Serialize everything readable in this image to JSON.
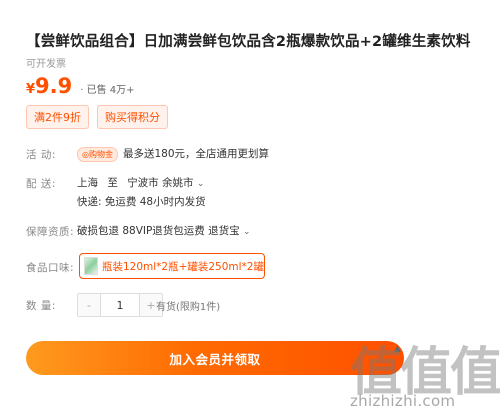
{
  "product": {
    "title": "【尝鲜饮品组合】日加满尝鲜包饮品含2瓶爆款饮品+2罐维生素饮料",
    "invoice": "可开发票",
    "currency": "¥",
    "price": "9.9",
    "sold": "· 已售 4万+"
  },
  "promos": [
    "满2件9折",
    "购买得积分"
  ],
  "activity": {
    "label": "活    动:",
    "badge": "◎购物金",
    "text": "最多送180元，全店通用更划算"
  },
  "shipping": {
    "label": "配    送:",
    "from": "上海",
    "to_word": "至",
    "location": "宁波市 余姚市",
    "chevron": "⌄",
    "detail": "快递: 免运费  48小时内发货"
  },
  "guarantee": {
    "label": "保障资质:",
    "text": "破损包退 88VIP退货包运费 退货宝",
    "chevron": "⌄"
  },
  "flavor": {
    "label": "食品口味:",
    "option": "瓶装120ml*2瓶+罐装250ml*2罐"
  },
  "quantity": {
    "label": "数    量:",
    "minus": "-",
    "value": "1",
    "plus": "+",
    "stock": "有货(限购1件)"
  },
  "buy_button": "加入会员并领取",
  "watermark": {
    "chars": [
      "值",
      "值",
      "值"
    ],
    "url": "zhizhizhi.com"
  },
  "colors": {
    "accent": "#ff5000",
    "accent_light": "#fff2ec"
  }
}
